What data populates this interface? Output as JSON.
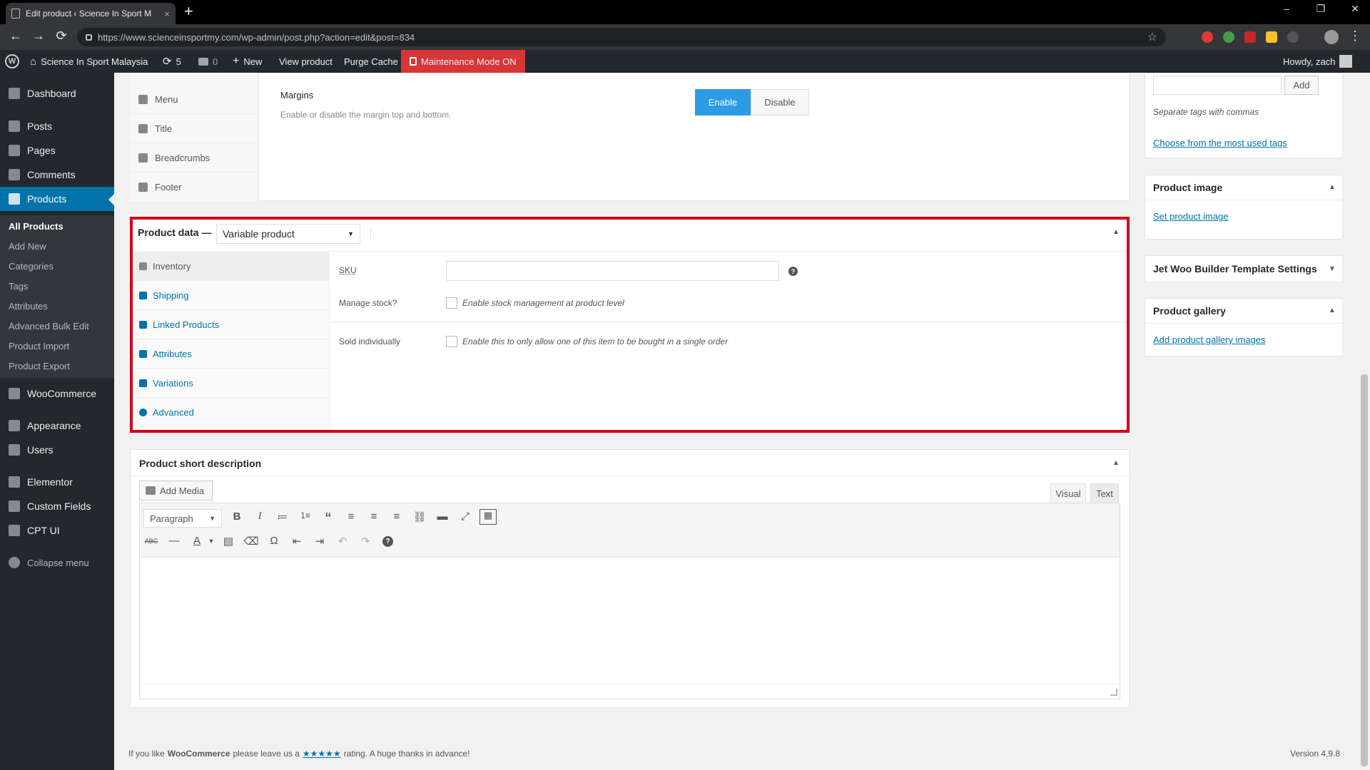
{
  "browser": {
    "tab_title": "Edit product ‹ Science In Sport M",
    "close_glyph": "×",
    "newtab_glyph": "+",
    "url": "https://www.scienceinsportmy.com/wp-admin/post.php?action=edit&post=834",
    "minimize": "–",
    "restore": "❐",
    "close": "✕",
    "back": "←",
    "forward": "→",
    "reload": "⟳",
    "star": "☆",
    "menu": "⋮"
  },
  "adminbar": {
    "wp_logo": "W",
    "site_name": "Science In Sport Malaysia",
    "updates_count": "5",
    "comments_count": "0",
    "new_label": "New",
    "view_product": "View product",
    "purge_cache": "Purge Cache",
    "maintenance": "Maintenance Mode ON",
    "howdy": "Howdy, zach"
  },
  "menu": {
    "items": [
      {
        "label": "Dashboard"
      },
      {
        "label": "Posts"
      },
      {
        "label": "Pages"
      },
      {
        "label": "Comments"
      },
      {
        "label": "Products"
      },
      {
        "label": "WooCommerce"
      },
      {
        "label": "Appearance"
      },
      {
        "label": "Users"
      },
      {
        "label": "Elementor"
      },
      {
        "label": "Custom Fields"
      },
      {
        "label": "CPT UI"
      },
      {
        "label": "Collapse menu"
      }
    ],
    "submenu": [
      "All Products",
      "Add New",
      "Categories",
      "Tags",
      "Attributes",
      "Advanced Bulk Edit",
      "Product Import",
      "Product Export"
    ]
  },
  "settings_box": {
    "tabs": [
      "Menu",
      "Title",
      "Breadcrumbs",
      "Footer"
    ],
    "field_label": "Margins",
    "field_desc": "Enable or disable the margin top and bottom.",
    "enable": "Enable",
    "disable": "Disable",
    "enable_selected": true
  },
  "product_data": {
    "title": "Product data —",
    "type_value": "Variable product",
    "tabs": [
      "Inventory",
      "Shipping",
      "Linked Products",
      "Attributes",
      "Variations",
      "Advanced"
    ],
    "sku_label": "SKU",
    "sku_value": "",
    "help": "?",
    "manage_stock_label": "Manage stock?",
    "manage_stock_desc": "Enable stock management at product level",
    "sold_individually_label": "Sold individually",
    "sold_individually_desc": "Enable this to only allow one of this item to be bought in a single order",
    "toggle": "▲",
    "highlight_color": "#d0021b"
  },
  "short_desc": {
    "title": "Product short description",
    "add_media": "Add Media",
    "visual_tab": "Visual",
    "text_tab": "Text",
    "format_select": "Paragraph",
    "toggle": "▲"
  },
  "sidebar": {
    "tags_add": "Add",
    "tags_hint": "Separate tags with commas",
    "tags_choose": "Choose from the most used tags",
    "product_image_title": "Product image",
    "set_product_image": "Set product image",
    "jet_title": "Jet Woo Builder Template Settings",
    "gallery_title": "Product gallery",
    "gallery_link": "Add product gallery images"
  },
  "footer": {
    "prefix": "If you like",
    "brand": "WooCommerce",
    "middle": "please leave us a",
    "stars": "★★★★★",
    "suffix": "rating. A huge thanks in advance!",
    "version": "Version 4.9.8"
  }
}
